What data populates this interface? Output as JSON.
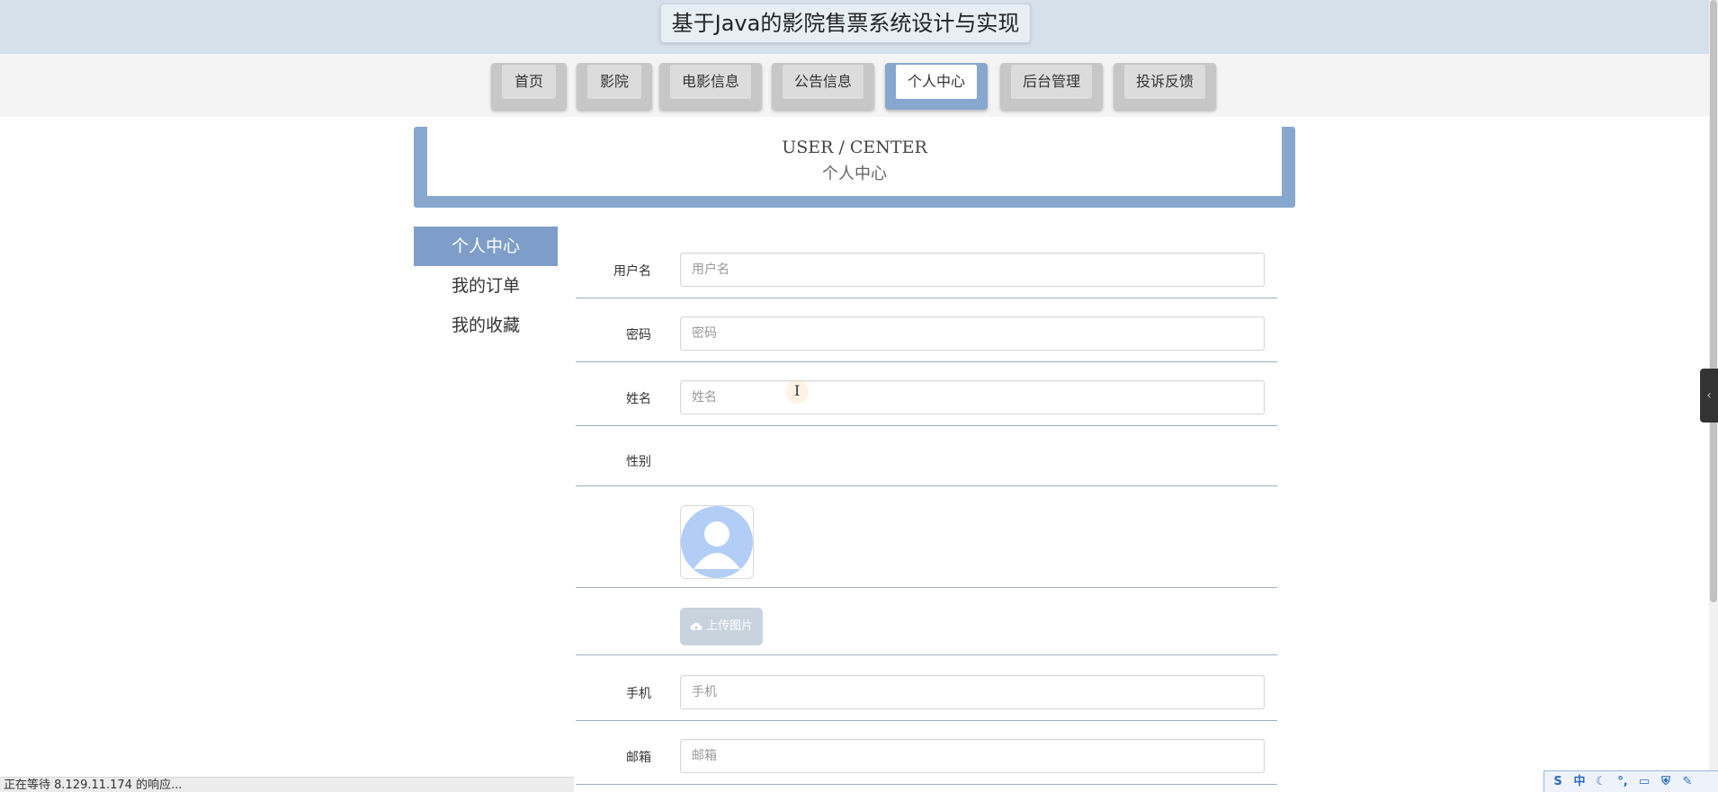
{
  "app": {
    "title": "基于Java的影院售票系统设计与实现"
  },
  "nav": {
    "items": [
      {
        "label": "首页"
      },
      {
        "label": "影院"
      },
      {
        "label": "电影信息"
      },
      {
        "label": "公告信息"
      },
      {
        "label": "个人中心"
      },
      {
        "label": "后台管理"
      },
      {
        "label": "投诉反馈"
      }
    ],
    "active_index": 4
  },
  "banner": {
    "title_en": "USER / CENTER",
    "title_cn": "个人中心"
  },
  "side_menu": {
    "items": [
      {
        "label": "个人中心"
      },
      {
        "label": "我的订单"
      },
      {
        "label": "我的收藏"
      }
    ],
    "active_index": 0
  },
  "form": {
    "username": {
      "label": "用户名",
      "placeholder": "用户名",
      "value": ""
    },
    "password": {
      "label": "密码",
      "placeholder": "密码",
      "value": ""
    },
    "name": {
      "label": "姓名",
      "placeholder": "姓名",
      "value": ""
    },
    "gender": {
      "label": "性别",
      "value": ""
    },
    "upload_label": "上传图片",
    "phone": {
      "label": "手机",
      "placeholder": "手机",
      "value": ""
    },
    "email": {
      "label": "邮箱",
      "placeholder": "邮箱",
      "value": ""
    }
  },
  "status_bar": {
    "text": "正在等待 8.129.11.174 的响应..."
  },
  "icons": {
    "avatar": "user-avatar-placeholder",
    "upload": "cloud-upload-icon",
    "side_toggle": "chevron-left-icon"
  },
  "colors": {
    "accent": "#88a7cf",
    "side_active": "#7e9ec9",
    "title_bar": "#d6e0ea",
    "avatar_fill": "#b2cdf6"
  }
}
